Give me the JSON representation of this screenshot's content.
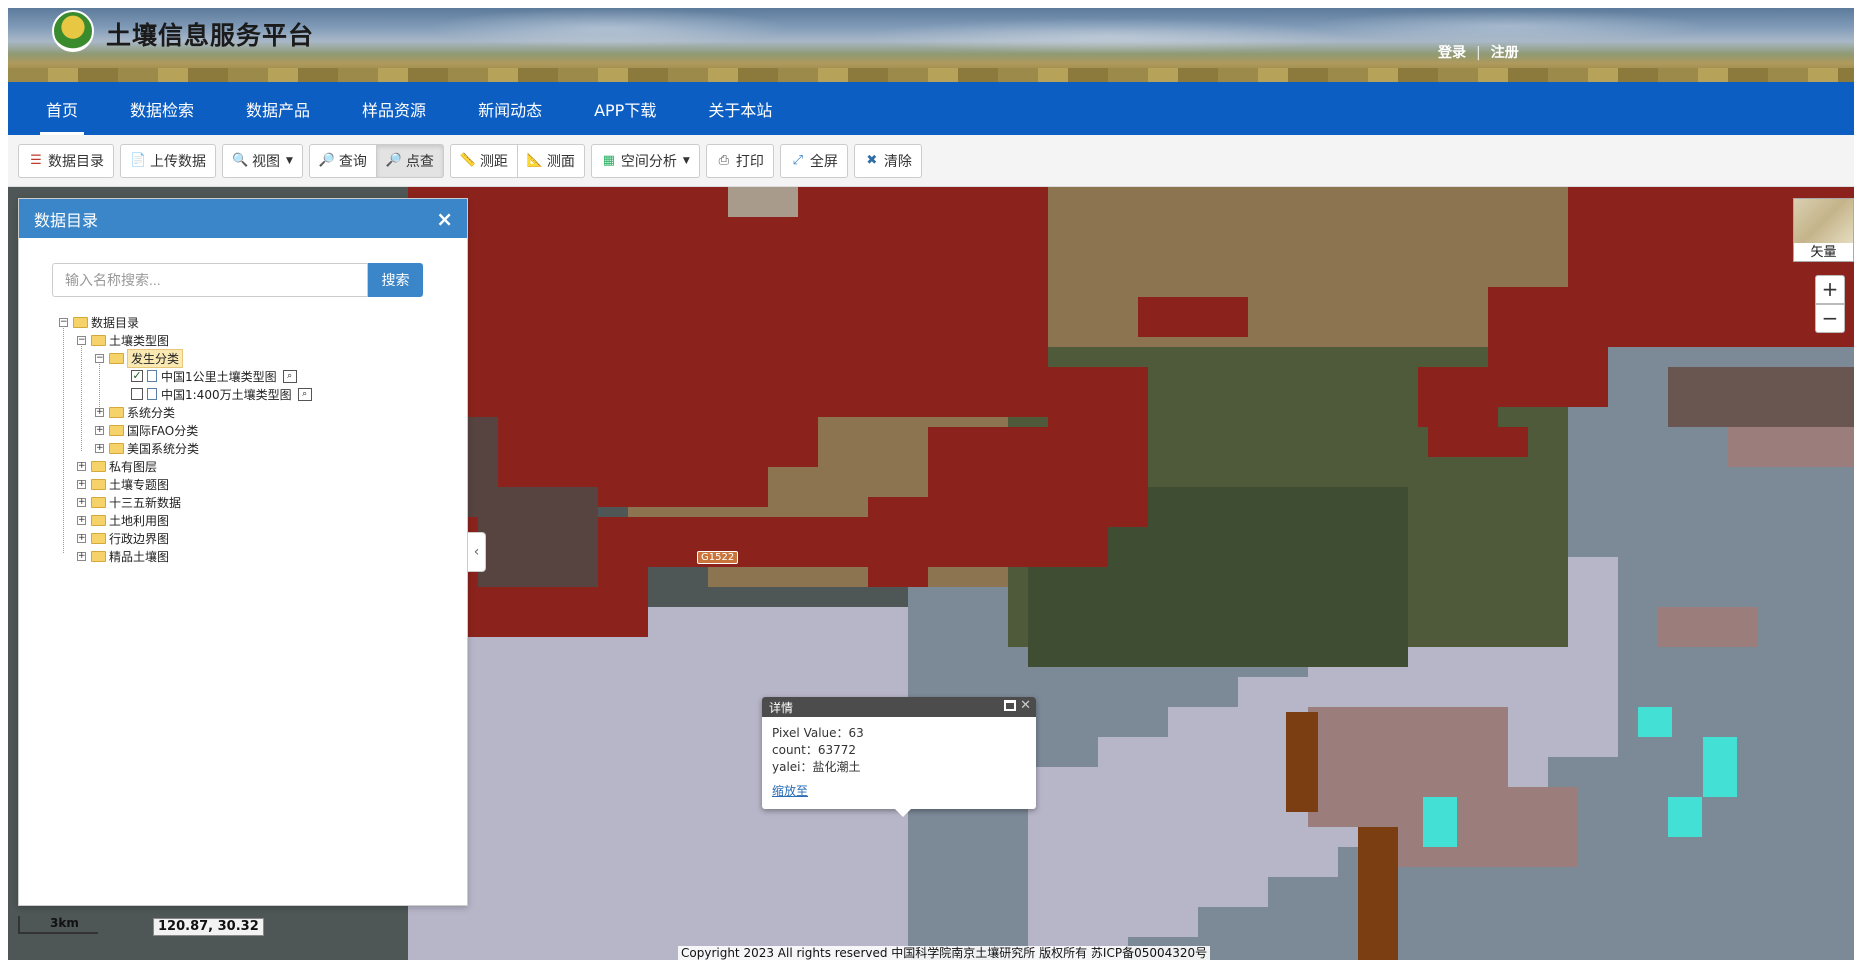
{
  "header": {
    "site_title": "土壤信息服务平台",
    "login": "登录",
    "separator": "|",
    "register": "注册"
  },
  "nav": {
    "items": [
      "首页",
      "数据检索",
      "数据产品",
      "样品资源",
      "新闻动态",
      "APP下载",
      "关于本站"
    ],
    "active": "首页"
  },
  "toolbar": {
    "catalog": "数据目录",
    "upload": "上传数据",
    "view": "视图",
    "query": "查询",
    "point_query": "点查",
    "measure_distance": "测距",
    "measure_area": "测面",
    "spatial_analysis": "空间分析",
    "print": "打印",
    "fullscreen": "全屏",
    "clear": "清除"
  },
  "panel": {
    "title": "数据目录",
    "close": "×",
    "search_placeholder": "输入名称搜索...",
    "search_button": "搜索",
    "tree": {
      "root": "数据目录",
      "soil_type_map": "土壤类型图",
      "genetic_classification": "发生分类",
      "layer_1km": "中国1公里土壤类型图",
      "layer_4m": "中国1:400万土壤类型图",
      "system_classification": "系统分类",
      "fao_classification": "国际FAO分类",
      "us_classification": "美国系统分类",
      "private_layers": "私有图层",
      "thematic_maps": "土壤专题图",
      "five_year_data": "十三五新数据",
      "land_use": "土地利用图",
      "admin_boundary": "行政边界图",
      "premium_soil": "精品土壤图"
    }
  },
  "map": {
    "basemap_label": "矢量",
    "zoom_in": "+",
    "zoom_out": "−",
    "collapse": "‹",
    "road_label": "G1522",
    "scale_label": "3km",
    "coordinates": "120.87, 30.32",
    "copyright": "Copyright 2023 All rights reserved 中国科学院南京土壤研究所 版权所有 苏ICP备05004320号",
    "colors": {
      "saline_red": "#8b231c",
      "tidal_flat": "#8c7450",
      "slate": "#7c8a98",
      "lavender": "#b7b5c8",
      "dark_gray": "#4e5755",
      "rose_gray": "#9b7e7c",
      "brown": "#7a3e12",
      "cyan": "#43e0d6"
    }
  },
  "popup": {
    "title": "详情",
    "pixel_label": "Pixel Value：",
    "pixel_value": "63",
    "count_label": "count：",
    "count_value": "63772",
    "yalei_label": "yalei：",
    "yalei_value": "盐化潮土",
    "zoom_link": "缩放至"
  }
}
